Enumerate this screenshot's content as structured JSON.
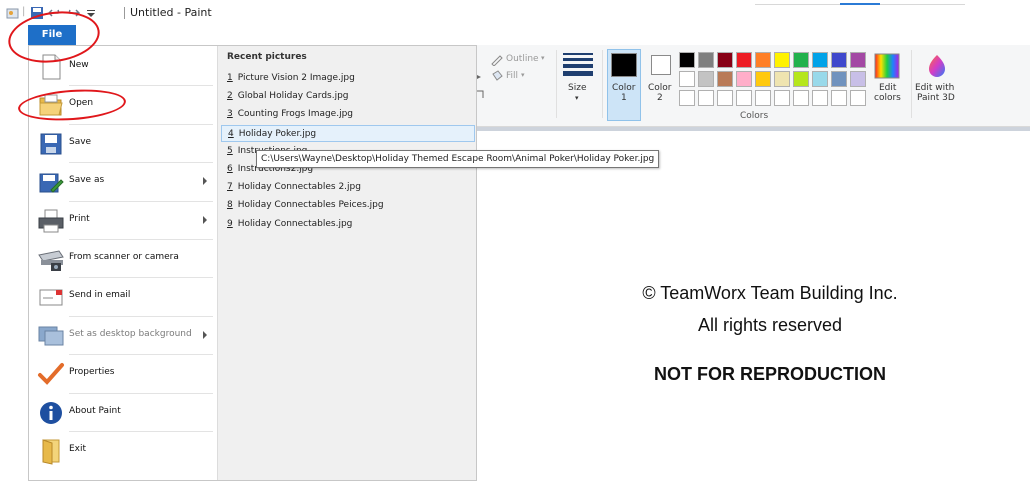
{
  "window": {
    "title": "Untitled - Paint"
  },
  "file_tab": {
    "label": "File"
  },
  "menu": {
    "items": [
      {
        "label": "New",
        "icon": "new-file-icon",
        "has_submenu": false,
        "enabled": true
      },
      {
        "label": "Open",
        "icon": "open-folder-icon",
        "has_submenu": false,
        "enabled": true
      },
      {
        "label": "Save",
        "icon": "save-disk-icon",
        "has_submenu": false,
        "enabled": true
      },
      {
        "label": "Save as",
        "icon": "save-as-icon",
        "has_submenu": true,
        "enabled": true
      },
      {
        "label": "Print",
        "icon": "printer-icon",
        "has_submenu": true,
        "enabled": true
      },
      {
        "label": "From scanner or camera",
        "icon": "scanner-icon",
        "has_submenu": false,
        "enabled": true
      },
      {
        "label": "Send in email",
        "icon": "email-icon",
        "has_submenu": false,
        "enabled": true
      },
      {
        "label": "Set as desktop background",
        "icon": "desktop-icon",
        "has_submenu": true,
        "enabled": false
      },
      {
        "label": "Properties",
        "icon": "checkmark-icon",
        "has_submenu": false,
        "enabled": true
      },
      {
        "label": "About Paint",
        "icon": "info-icon",
        "has_submenu": false,
        "enabled": true
      },
      {
        "label": "Exit",
        "icon": "exit-folder-icon",
        "has_submenu": false,
        "enabled": true
      }
    ]
  },
  "recent": {
    "title": "Recent pictures",
    "items": [
      {
        "num": "1",
        "name": "Picture Vision 2 Image.jpg"
      },
      {
        "num": "2",
        "name": "Global Holiday Cards.jpg"
      },
      {
        "num": "3",
        "name": "Counting Frogs Image.jpg"
      },
      {
        "num": "4",
        "name": "Holiday Poker.jpg"
      },
      {
        "num": "5",
        "name": "Instructions.jpg"
      },
      {
        "num": "6",
        "name": "Instructions2.jpg"
      },
      {
        "num": "7",
        "name": "Holiday Connectables 2.jpg"
      },
      {
        "num": "8",
        "name": "Holiday Connectables Peices.jpg"
      },
      {
        "num": "9",
        "name": "Holiday Connectables.jpg"
      }
    ],
    "highlighted_index": 3,
    "tooltip": "C:\\Users\\Wayne\\Desktop\\Holiday Themed Escape Room\\Animal Poker\\Holiday Poker.jpg"
  },
  "ribbon": {
    "outline_label": "Outline",
    "fill_label": "Fill",
    "size_label": "Size",
    "color1_label": "Color",
    "color1_num": "1",
    "color2_label": "Color",
    "color2_num": "2",
    "edit_colors_label1": "Edit",
    "edit_colors_label2": "colors",
    "paint3d_label1": "Edit with",
    "paint3d_label2": "Paint 3D",
    "colors_group_label": "Colors",
    "palette_row1": [
      "#000000",
      "#7f7f7f",
      "#880015",
      "#ed1c24",
      "#ff7f27",
      "#fff200",
      "#22b14c",
      "#00a2e8",
      "#3f48cc",
      "#a349a4"
    ],
    "palette_row2": [
      "#ffffff",
      "#c3c3c3",
      "#b97a57",
      "#ffaec9",
      "#ffc90e",
      "#efe4b0",
      "#b5e61d",
      "#99d9ea",
      "#7092be",
      "#c8bfe7"
    ],
    "palette_row3": [
      "#ffffff",
      "#ffffff",
      "#ffffff",
      "#ffffff",
      "#ffffff",
      "#ffffff",
      "#ffffff",
      "#ffffff",
      "#ffffff",
      "#ffffff"
    ]
  },
  "watermark": {
    "line1": "© TeamWorx Team Building Inc.",
    "line2": "All rights reserved",
    "line3": "NOT FOR REPRODUCTION"
  },
  "colors": {
    "file_tab_bg": "#1e6fc8",
    "annotation_ring": "#e0171b",
    "highlight_bg": "#e5f1fb"
  }
}
